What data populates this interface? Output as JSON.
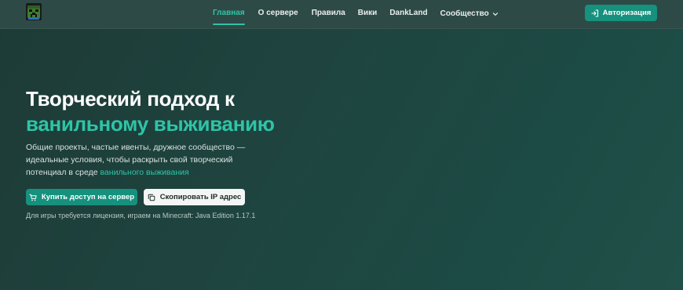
{
  "nav": {
    "logo_icon": "creeper-avatar-icon",
    "links": [
      {
        "label": "Главная",
        "active": true
      },
      {
        "label": "О сервере"
      },
      {
        "label": "Правила"
      },
      {
        "label": "Вики"
      },
      {
        "label": "DankLand"
      },
      {
        "label": "Сообщество",
        "icon": "chevron-down-icon"
      }
    ],
    "auth_button": {
      "label": "Авторизация",
      "icon": "login-icon"
    }
  },
  "hero": {
    "title_line1": "Творческий подход к",
    "title_line2": "ванильному выживанию",
    "description_part1": "Общие проекты, частые ивенты, дружное сообщество — идеальные условия, чтобы раскрыть свой творческий потенциал в среде ",
    "description_highlight": "ванильного выживания",
    "buy_button": {
      "label": "Купить доступ на сервер",
      "icon": "cart-icon"
    },
    "copy_button": {
      "label": "Скопировать IP адрес",
      "icon": "copy-icon"
    },
    "note": "Для игры требуется лицензия, играем на Minecraft: Java Edition 1.17.1"
  },
  "colors": {
    "accent": "#2ec4a7",
    "button_primary": "#15917d",
    "navbar_bg": "#2e4a46",
    "page_bg": "#1f4540"
  }
}
